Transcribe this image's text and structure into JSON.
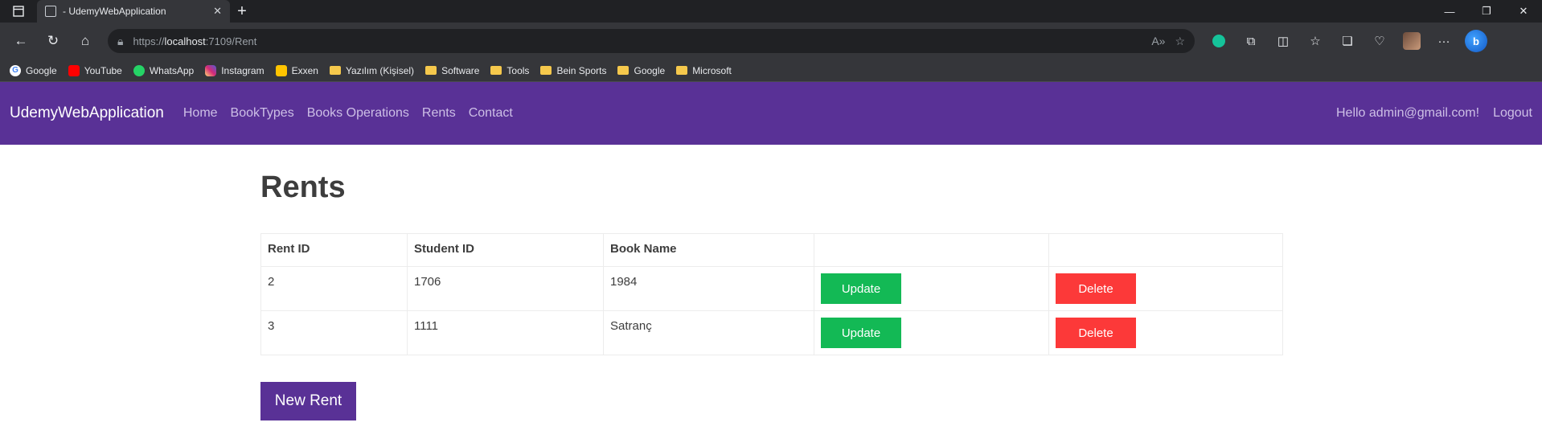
{
  "browser": {
    "tab_title": "- UdemyWebApplication",
    "tab_close": "✕",
    "new_tab": "+",
    "url_scheme": "https://",
    "url_host": "localhost",
    "url_path": ":7109/Rent",
    "window_controls": [
      "—",
      "❐",
      "✕"
    ]
  },
  "bookmarks": [
    {
      "label": "Google",
      "icon": "google-icon"
    },
    {
      "label": "YouTube",
      "icon": "youtube-icon"
    },
    {
      "label": "WhatsApp",
      "icon": "whatsapp-icon"
    },
    {
      "label": "Instagram",
      "icon": "instagram-icon"
    },
    {
      "label": "Exxen",
      "icon": "exxen-icon"
    },
    {
      "label": "Yazılım (Kişisel)",
      "icon": "folder-icon"
    },
    {
      "label": "Software",
      "icon": "folder-icon"
    },
    {
      "label": "Tools",
      "icon": "folder-icon"
    },
    {
      "label": "Bein Sports",
      "icon": "folder-icon"
    },
    {
      "label": "Google",
      "icon": "folder-icon"
    },
    {
      "label": "Microsoft",
      "icon": "folder-icon"
    }
  ],
  "navbar": {
    "brand": "UdemyWebApplication",
    "links": [
      "Home",
      "BookTypes",
      "Books Operations",
      "Rents",
      "Contact"
    ],
    "greeting": "Hello admin@gmail.com!",
    "logout": "Logout"
  },
  "page": {
    "title": "Rents",
    "columns": [
      "Rent ID",
      "Student ID",
      "Book Name"
    ],
    "rows": [
      {
        "rent_id": "2",
        "student_id": "1706",
        "book_name": "1984",
        "update": "Update",
        "delete": "Delete"
      },
      {
        "rent_id": "3",
        "student_id": "1111",
        "book_name": "Satranç",
        "update": "Update",
        "delete": "Delete"
      }
    ],
    "new_button": "New Rent"
  },
  "colors": {
    "navbar": "#593196",
    "update": "#13b955",
    "delete": "#fc3939"
  }
}
